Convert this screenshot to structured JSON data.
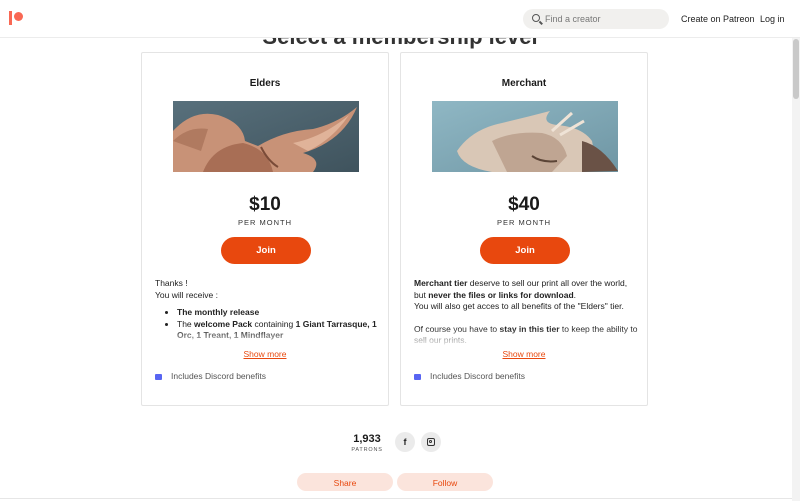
{
  "header": {
    "search_placeholder": "Find a creator",
    "create_label": "Create on Patreon",
    "login_label": "Log in"
  },
  "section_heading": "Select a membership level",
  "tiers": [
    {
      "title": "Elders",
      "price": "$10",
      "period": "PER MONTH",
      "join_label": "Join",
      "intro1": "Thanks !",
      "intro2": "You will receive :",
      "bullet1": "The monthly release",
      "bullet2_pre": "The ",
      "bullet2_bold1": "welcome Pack",
      "bullet2_mid": " containing ",
      "bullet2_bold2": "1 Giant Tarrasque, 1 Orc, 1 Treant, 1 Mindflayer",
      "show_more": "Show more",
      "discord": "Includes Discord benefits"
    },
    {
      "title": "Merchant",
      "price": "$40",
      "period": "PER MONTH",
      "join_label": "Join",
      "p1_bold1": "Merchant tier",
      "p1_mid": " deserve to sell our print all over the world, but ",
      "p1_bold2": "never the files or links for download",
      "p1_end": ".",
      "p2": "You will also get acces to all benefits of the \"Elders\" tier.",
      "p3_pre": "Of course you have to ",
      "p3_bold": "stay in this tier",
      "p3_end": " to keep the ability to sell our prints.",
      "show_more": "Show more",
      "discord": "Includes Discord benefits"
    }
  ],
  "patrons": {
    "count": "1,933",
    "label": "PATRONS"
  },
  "social": {
    "facebook_glyph": "f"
  },
  "actions": {
    "share": "Share",
    "follow": "Follow"
  },
  "colors": {
    "accent": "#e8480e",
    "logo": "#f96854",
    "pill_bg": "#fbe4dc"
  }
}
